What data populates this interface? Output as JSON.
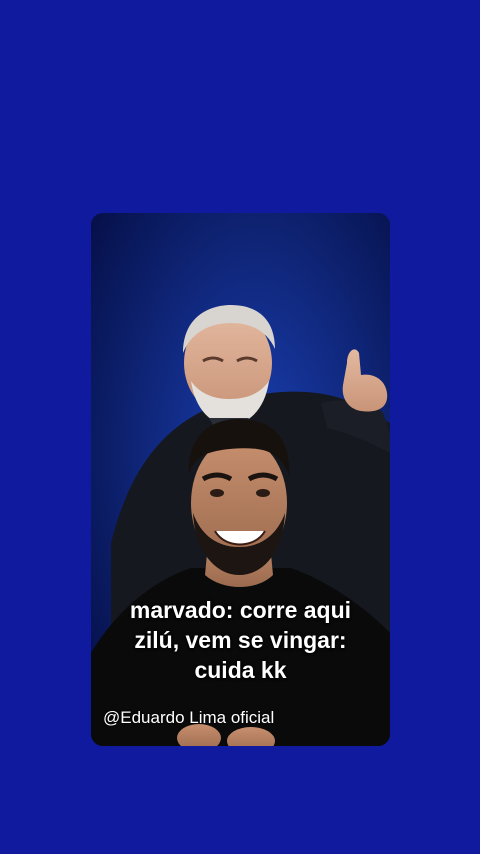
{
  "background_color": "#0f1a9e",
  "video": {
    "caption_lines": [
      "marvado: corre aqui",
      "zilú, vem se vingar:",
      "cuida kk"
    ],
    "watermark": "@Eduardo Lima oficial"
  }
}
